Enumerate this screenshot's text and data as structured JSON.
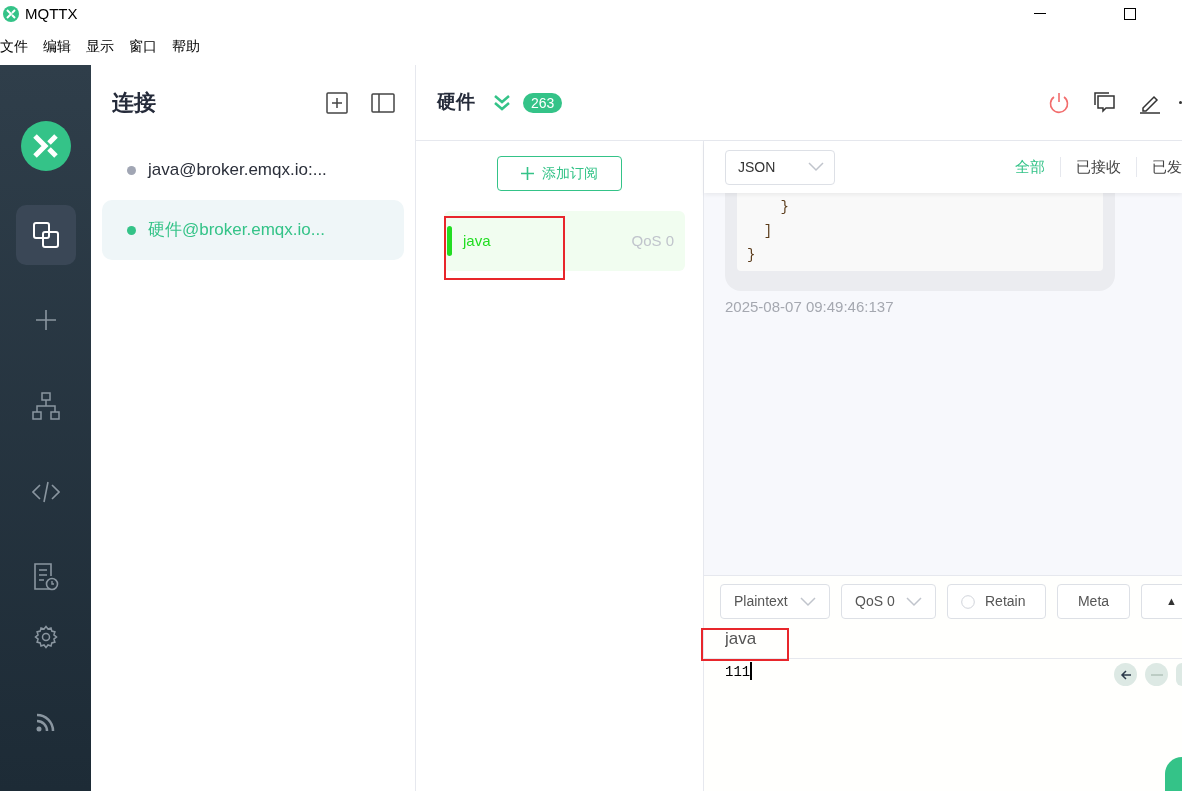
{
  "window": {
    "title": "MQTTX"
  },
  "menu": [
    "文件",
    "编辑",
    "显示",
    "窗口",
    "帮助"
  ],
  "nav": [
    {
      "kind": "connections",
      "selected": true
    },
    {
      "kind": "new",
      "selected": false
    },
    {
      "kind": "tree",
      "selected": false
    },
    {
      "kind": "script",
      "selected": false
    },
    {
      "kind": "log",
      "selected": false
    },
    {
      "kind": "settings",
      "selected": false
    },
    {
      "kind": "feed",
      "selected": false
    }
  ],
  "connections_panel": {
    "title": "连接",
    "items": [
      {
        "name": "java@broker.emqx.io:...",
        "connected": false,
        "selected": false
      },
      {
        "name": "硬件@broker.emqx.io...",
        "connected": true,
        "selected": true
      }
    ]
  },
  "header": {
    "title": "硬件",
    "count": "263"
  },
  "subscriptions": {
    "add_button": "添加订阅",
    "items": [
      {
        "topic": "java",
        "qos": "QoS 0",
        "color": "#22dd22",
        "annotated": true
      }
    ]
  },
  "messages": {
    "format": "JSON",
    "filters": [
      {
        "label": "全部",
        "selected": true
      },
      {
        "label": "已接收",
        "selected": false
      },
      {
        "label": "已发",
        "selected": false
      }
    ],
    "bubble_lines": [
      "    }",
      "  ]",
      "}"
    ],
    "time": "2025-08-07 09:49:46:137"
  },
  "composer": {
    "format": "Plaintext",
    "qos": "QoS 0",
    "retain": {
      "label": "Retain",
      "checked": false
    },
    "meta": "Meta",
    "expand": "▲",
    "topic": {
      "value": "java",
      "annotated": true
    },
    "payload": "111"
  }
}
